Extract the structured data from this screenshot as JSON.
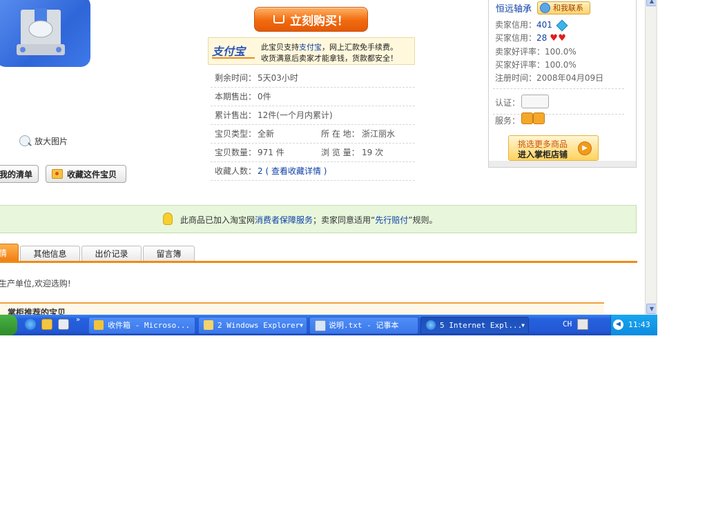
{
  "buy_now": {
    "label": "立刻购买！"
  },
  "product": {
    "zoom_label": "放大图片"
  },
  "actions": {
    "my_list": "我的清单",
    "favorite": "收藏这件宝贝"
  },
  "alipay": {
    "logo": "支付宝",
    "line1_pre": "此宝贝支持",
    "line1_link": "支付宝",
    "line1_post": "，网上汇款免手续费。",
    "line2": "收货满意后卖家才能拿钱，货款都安全！"
  },
  "info": {
    "remaining_label": "剩余时间：",
    "remaining": "5天03小时",
    "period_sold_label": "本期售出：",
    "period_sold": "0件",
    "total_sold_label": "累计售出：",
    "total_sold": "12件(一个月内累计)",
    "type_label": "宝贝类型：",
    "type": "全新",
    "location_label": "所 在 地：",
    "location": "浙江丽水",
    "quantity_label": "宝贝数量：",
    "quantity": "971 件",
    "views_label": "浏 览 量：",
    "views": "19 次",
    "favorites_label": "收藏人数：",
    "favorites_count": "2",
    "favorites_link": "( 查看收藏详情 )"
  },
  "seller": {
    "name": "恒远轴承",
    "contact": "和我联系",
    "seller_credit_label": "卖家信用：",
    "seller_credit": "401",
    "buyer_credit_label": "买家信用：",
    "buyer_credit": "28",
    "seller_rating_label": "卖家好评率：",
    "seller_rating": "100.0%",
    "buyer_rating_label": "买家好评率：",
    "buyer_rating": "100.0%",
    "register_label": "注册时间：",
    "register_date": "2008年04月09日",
    "cert_label": "认证：",
    "service_label": "服务：",
    "store_line1": "挑选更多商品",
    "store_line2": "进入掌柜店铺"
  },
  "guarantee": {
    "pre": "此商品已加入淘宝网",
    "link1": "消费者保障服务",
    "mid": "；卖家同意适用“",
    "link2": "先行赔付",
    "post": "”规则。"
  },
  "tabs": {
    "active": "情",
    "other": "其他信息",
    "bids": "出价记录",
    "guestbook": "留言簿"
  },
  "description": "生产单位,欢迎选购!",
  "recommend_title": "掌柜推荐的宝贝",
  "taskbar": {
    "tasks": [
      {
        "label": "收件箱 - Microso..."
      },
      {
        "label": "2 Windows Explorer"
      },
      {
        "label": "说明.txt - 记事本"
      },
      {
        "label": "5 Internet Expl..."
      }
    ],
    "language": "CH",
    "clock": "11:43"
  },
  "colors": {
    "accent_orange": "#f08a10",
    "link_blue": "#0d3fa6",
    "taskbar_blue": "#2358d6"
  }
}
